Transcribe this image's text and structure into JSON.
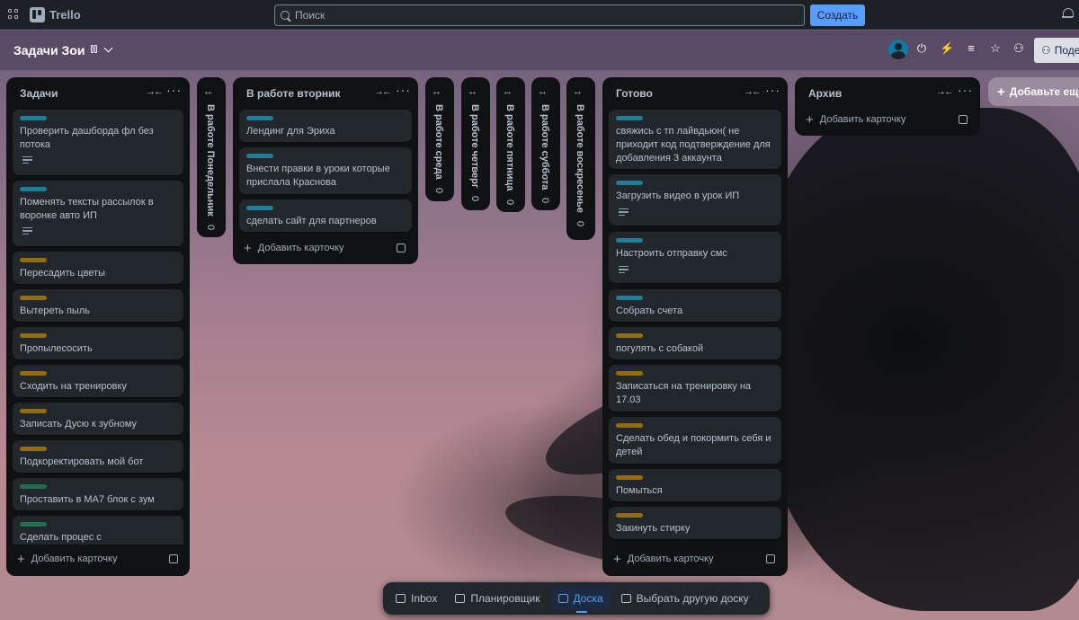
{
  "topbar": {
    "app_name": "Trello",
    "search_placeholder": "Поиск",
    "create_label": "Создать"
  },
  "board": {
    "title": "Задачи Зои",
    "share_label": "Поде",
    "add_list_label": "Добавьте еще"
  },
  "add_card_label": "Добавить карточку",
  "lists": [
    {
      "title": "Задачи",
      "cards": [
        {
          "label_color": "#227d9b",
          "text": "Проверить дашборда фл без потока",
          "has_description": true
        },
        {
          "label_color": "#227d9b",
          "text": "Поменять тексты рассылок в воронке авто ИП",
          "has_description": true
        },
        {
          "label_color": "#946f00",
          "text": "Пересадить цветы"
        },
        {
          "label_color": "#946f00",
          "text": "Вытереть пыль"
        },
        {
          "label_color": "#946f00",
          "text": "Пропылесосить"
        },
        {
          "label_color": "#946f00",
          "text": "Сходить на тренировку"
        },
        {
          "label_color": "#946f00",
          "text": "Записать Дусю к зубному"
        },
        {
          "label_color": "#946f00",
          "text": "Подкоректировать мой бот"
        },
        {
          "label_color": "#216e4e",
          "text": "Проставить в МА7 блок с зум"
        },
        {
          "label_color": "#216e4e",
          "text": "Сделать процес с"
        }
      ]
    },
    {
      "title": "В работе вторник",
      "cards": [
        {
          "label_color": "#227d9b",
          "text": "Лендинг для Эриха"
        },
        {
          "label_color": "#227d9b",
          "text": "Внести правки в уроки которые прислала Краснова"
        },
        {
          "label_color": "#227d9b",
          "text": "сделать сайт для партнеров"
        }
      ]
    },
    {
      "title": "Готово",
      "cards": [
        {
          "label_color": "#227d9b",
          "text": "свяжись с тп лайвдьюн( не приходит код подтверждение для добавления 3 аккаунта"
        },
        {
          "label_color": "#227d9b",
          "text": "Загрузить видео в урок ИП",
          "has_description": true
        },
        {
          "label_color": "#227d9b",
          "text": "Настроить отправку смс",
          "has_description": true
        },
        {
          "label_color": "#227d9b",
          "text": "Собрать счета"
        },
        {
          "label_color": "#946f00",
          "text": "погулять с собакой"
        },
        {
          "label_color": "#946f00",
          "text": "Записаться на тренировку на 17.03"
        },
        {
          "label_color": "#946f00",
          "text": "Сделать обед и покормить себя и детей"
        },
        {
          "label_color": "#946f00",
          "text": "Помыться"
        },
        {
          "label_color": "#946f00",
          "text": "Закинуть стирку"
        }
      ]
    },
    {
      "title": "Архив",
      "cards": []
    }
  ],
  "collapsed_lists": [
    {
      "title": "В работе Понедельник",
      "count": "0"
    },
    {
      "title": "В работе среда",
      "count": "0"
    },
    {
      "title": "В работе четверг",
      "count": "0"
    },
    {
      "title": "В работе пятница",
      "count": "0"
    },
    {
      "title": "В работе суббота",
      "count": "0"
    },
    {
      "title": "В работе воскресенье",
      "count": "0"
    }
  ],
  "switcher": {
    "inbox": "Inbox",
    "planner": "Планировщик",
    "board": "Доска",
    "switch_board": "Выбрать другую доску"
  },
  "icons": {
    "apps": "apps-grid-icon",
    "search": "search-icon",
    "notifications": "bell-icon",
    "power_ups": "plug-icon",
    "automation": "lightning-icon",
    "filter": "filter-icon",
    "star": "star-icon",
    "visibility": "people-icon"
  },
  "colors": {
    "accent": "#579dff",
    "label_blue": "#227d9b",
    "label_yellow": "#946f00",
    "label_green": "#216e4e"
  }
}
